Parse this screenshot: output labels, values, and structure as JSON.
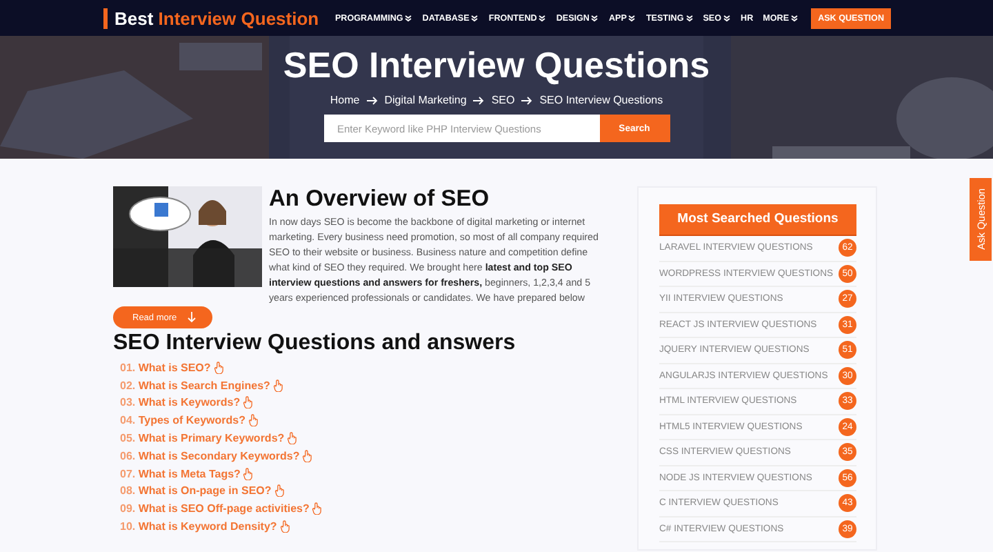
{
  "header": {
    "logo": {
      "prefix": "Best",
      "highlight": "Interview Question"
    },
    "nav": [
      {
        "label": "PROGRAMMING",
        "has_menu": true
      },
      {
        "label": "DATABASE",
        "has_menu": true
      },
      {
        "label": "FRONTEND",
        "has_menu": true
      },
      {
        "label": "DESIGN",
        "has_menu": true
      },
      {
        "label": "APP",
        "has_menu": true
      },
      {
        "label": "TESTING",
        "has_menu": true
      },
      {
        "label": "SEO",
        "has_menu": true
      },
      {
        "label": "HR",
        "has_menu": false
      },
      {
        "label": "MORE",
        "has_menu": true
      }
    ],
    "cta": "ASK QUESTION"
  },
  "hero": {
    "title": "SEO Interview Questions",
    "breadcrumb": [
      "Home",
      "Digital Marketing",
      "SEO",
      "SEO Interview Questions"
    ],
    "search": {
      "placeholder": "Enter Keyword like PHP Interview Questions",
      "button": "Search"
    }
  },
  "overview": {
    "title": "An Overview of SEO",
    "text": "In now days SEO is become the backbone of digital marketing or internet marketing. Every business need promotion, so most of all company required SEO to their website or business. Business nature and competition define what kind of SEO they required. We brought here **latest and top SEO interview questions and answers for freshers,** beginners, 1,2,3,4 and 5 years experienced professionals or candidates. We have prepared below",
    "read_more": "Read more"
  },
  "questions": {
    "title": "SEO Interview Questions and answers",
    "items": [
      {
        "number": "01.",
        "text": "What is SEO?"
      },
      {
        "number": "02.",
        "text": "What is Search Engines?"
      },
      {
        "number": "03.",
        "text": "What is Keywords?"
      },
      {
        "number": "04.",
        "text": "Types of Keywords?"
      },
      {
        "number": "05.",
        "text": "What is Primary Keywords?"
      },
      {
        "number": "06.",
        "text": "What is Secondary Keywords?"
      },
      {
        "number": "07.",
        "text": "What is Meta Tags?"
      },
      {
        "number": "08.",
        "text": "What is On-page in SEO?"
      },
      {
        "number": "09.",
        "text": "What is SEO Off-page activities?"
      },
      {
        "number": "10.",
        "text": "What is Keyword Density?"
      }
    ]
  },
  "sidebar": {
    "title": "Most Searched Questions",
    "items": [
      {
        "label": "LARAVEL INTERVIEW QUESTIONS",
        "count": "62"
      },
      {
        "label": "WORDPRESS INTERVIEW QUESTIONS",
        "count": "50"
      },
      {
        "label": "YII INTERVIEW QUESTIONS",
        "count": "27"
      },
      {
        "label": "REACT JS INTERVIEW QUESTIONS",
        "count": "31"
      },
      {
        "label": "JQUERY INTERVIEW QUESTIONS",
        "count": "51"
      },
      {
        "label": "ANGULARJS INTERVIEW QUESTIONS",
        "count": "30"
      },
      {
        "label": "HTML INTERVIEW QUESTIONS",
        "count": "33"
      },
      {
        "label": "HTML5 INTERVIEW QUESTIONS",
        "count": "24"
      },
      {
        "label": "CSS INTERVIEW QUESTIONS",
        "count": "35"
      },
      {
        "label": "NODE JS INTERVIEW QUESTIONS",
        "count": "56"
      },
      {
        "label": "C INTERVIEW QUESTIONS",
        "count": "43"
      },
      {
        "label": "C# INTERVIEW QUESTIONS",
        "count": "39"
      }
    ]
  },
  "side_tab": "Ask Question"
}
